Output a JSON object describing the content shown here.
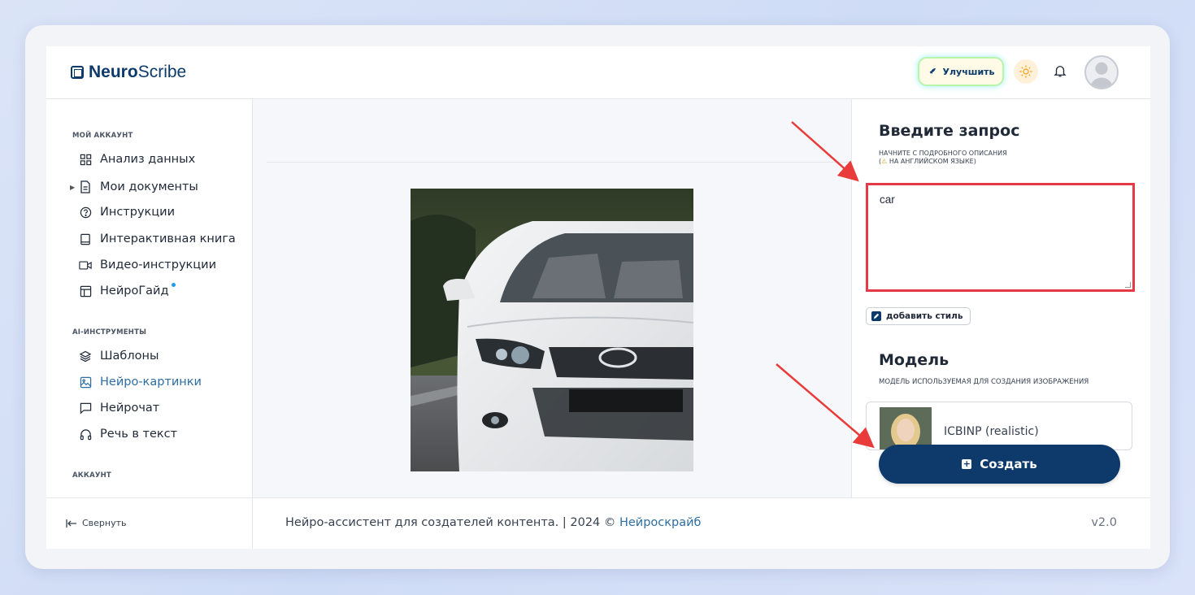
{
  "header": {
    "logo_bold": "Neuro",
    "logo_rest": "Scribe",
    "upgrade_label": "Улучшить"
  },
  "sidebar": {
    "section_account": "МОЙ АККАУНТ",
    "items_account": [
      {
        "label": "Анализ данных",
        "icon": "grid-icon"
      },
      {
        "label": "Мои документы",
        "icon": "document-icon"
      },
      {
        "label": "Инструкции",
        "icon": "help-circle-icon"
      },
      {
        "label": "Интерактивная книга",
        "icon": "book-icon"
      },
      {
        "label": "Видео-инструкции",
        "icon": "video-icon"
      },
      {
        "label": "НейроГайд",
        "icon": "layout-icon"
      }
    ],
    "section_ai": "AI-ИНСТРУМЕНТЫ",
    "items_ai": [
      {
        "label": "Шаблоны",
        "icon": "layers-icon"
      },
      {
        "label": "Нейро-картинки",
        "icon": "image-icon"
      },
      {
        "label": "Нейрочат",
        "icon": "chat-icon"
      },
      {
        "label": "Речь в текст",
        "icon": "headphones-icon"
      }
    ],
    "section_acc2": "АККАУНТ"
  },
  "prompt": {
    "title": "Введите запрос",
    "subtitle_line1": "НАЧНИТЕ С ПОДРОБНОГО ОПИСАНИЯ",
    "subtitle_line2_open": "(",
    "subtitle_line2": " НА АНГЛИЙСКОМ ЯЗЫКЕ)",
    "value": "car",
    "add_style": "добавить стиль"
  },
  "model": {
    "title": "Модель",
    "subtitle": "МОДЕЛЬ ИСПОЛЬЗУЕМАЯ ДЛЯ СОЗДАНИЯ ИЗОБРАЖЕНИЯ",
    "selected": "ICBINP (realistic)"
  },
  "actions": {
    "create": "Создать"
  },
  "footer": {
    "collapse": "Свернуть",
    "text": "Нейро-ассистент для создателей контента.  | 2024 © ",
    "link": "Нейроскрайб",
    "version": "v2.0"
  },
  "colors": {
    "brand": "#0c3a6b",
    "accent_link": "#2d6ea3",
    "highlight_red": "#e8394a"
  }
}
